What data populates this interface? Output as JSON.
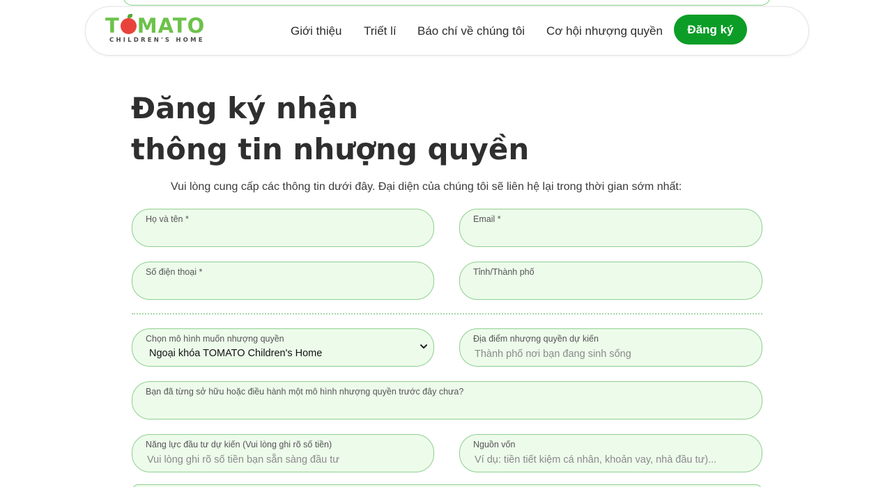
{
  "brand": {
    "logo_before": "T",
    "logo_after": "MATO",
    "logo_sub": "CHILDREN'S HOME"
  },
  "nav": {
    "items": [
      "Giới thiệu",
      "Triết lí",
      "Báo chí về chúng tôi",
      "Cơ hội nhượng quyền"
    ],
    "signup_label": "Đăng ký"
  },
  "page": {
    "title_line1": "Đăng ký nhận",
    "title_line2": "thông tin nhượng quyền",
    "intro": "Vui lòng cung cấp các thông tin dưới đây. Đại diện của chúng tôi sẽ liên hệ lại trong thời gian sớm nhất:"
  },
  "form": {
    "name": {
      "label": "Họ và tên *",
      "value": ""
    },
    "email": {
      "label": "Email *",
      "value": ""
    },
    "phone": {
      "label": "Số điện thoại *",
      "value": ""
    },
    "city": {
      "label": "Tỉnh/Thành phố",
      "value": ""
    },
    "model": {
      "label": "Chọn mô hình muốn nhượng quyền",
      "selected": "Ngoại khóa TOMATO Children's Home"
    },
    "location": {
      "label": "Địa điểm nhượng quyền dự kiến",
      "placeholder": "Thành phố nơi bạn đang sinh sống"
    },
    "experience": {
      "label": "Bạn đã từng sở hữu hoặc điều hành một mô hình nhượng quyền trước đây chưa?",
      "value": ""
    },
    "capacity": {
      "label": "Năng lực đầu tư dự kiến (Vui lòng ghi rõ số tiền)",
      "placeholder": "Vui lòng ghi rõ số tiền bạn sẵn sàng đầu tư"
    },
    "funding": {
      "label": "Nguồn vốn",
      "placeholder": "Ví dụ: tiền tiết kiệm cá nhân, khoản vay, nhà đầu tư)..."
    }
  },
  "colors": {
    "brand_green": "#6cc24a",
    "button_green": "#0c9d27",
    "tomato_red": "#e8433b",
    "field_bg": "#edfbeb",
    "field_border": "#8ed08e"
  }
}
